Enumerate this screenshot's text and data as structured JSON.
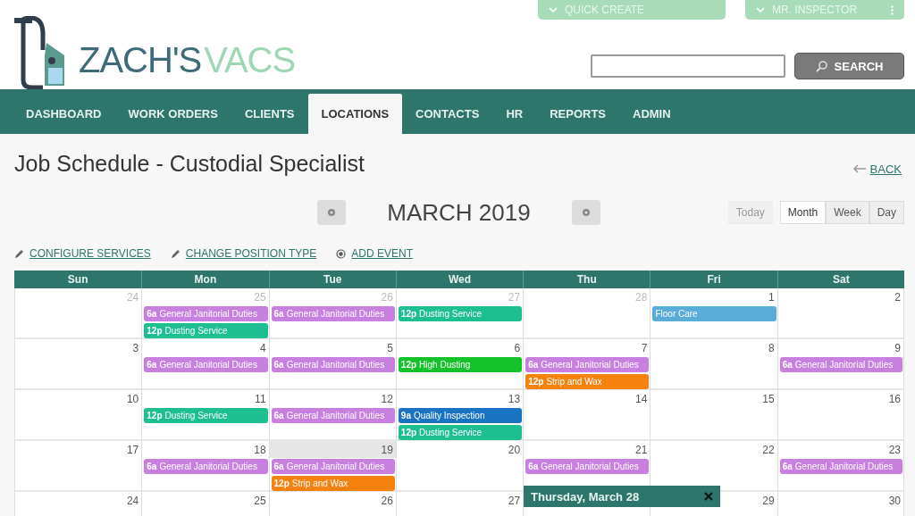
{
  "brand": {
    "name_part_1": "ZACH'S",
    "name_part_2": "VACS"
  },
  "top_menus": [
    {
      "label": "QUICK CREATE",
      "has_more": false
    },
    {
      "label": "MR. INSPECTOR",
      "has_more": true
    }
  ],
  "search": {
    "button": "SEARCH"
  },
  "nav": [
    {
      "label": "DASHBOARD",
      "selected": false
    },
    {
      "label": "WORK ORDERS",
      "selected": false
    },
    {
      "label": "CLIENTS",
      "selected": false
    },
    {
      "label": "LOCATIONS",
      "selected": true
    },
    {
      "label": "CONTACTS",
      "selected": false
    },
    {
      "label": "HR",
      "selected": false
    },
    {
      "label": "REPORTS",
      "selected": false
    },
    {
      "label": "ADMIN",
      "selected": false
    }
  ],
  "page_title": "Job Schedule - Custodial Specialist",
  "back_link": "BACK",
  "calendar": {
    "month_title": "MARCH 2019",
    "today_button": {
      "label": "Today",
      "disabled": true
    },
    "views": [
      {
        "label": "Month",
        "selected": true
      },
      {
        "label": "Week",
        "selected": false
      },
      {
        "label": "Day",
        "selected": false
      }
    ],
    "actions": [
      {
        "label": "CONFIGURE SERVICES",
        "kind": "edit"
      },
      {
        "label": "CHANGE POSITION TYPE",
        "kind": "edit"
      },
      {
        "label": "ADD EVENT",
        "kind": "add"
      }
    ],
    "weekdays": [
      "Sun",
      "Mon",
      "Tue",
      "Wed",
      "Thu",
      "Fri",
      "Sat"
    ],
    "weeks": [
      [
        {
          "day": "24",
          "other_month": true,
          "highlighted": false
        },
        {
          "day": "25",
          "other_month": true,
          "highlighted": false,
          "events": [
            {
              "time": "6a",
              "title": "General Janitorial Duties",
              "color": "#c77fe0"
            },
            {
              "time": "12p",
              "title": "Dusting Service",
              "color": "#1dbf91"
            }
          ]
        },
        {
          "day": "26",
          "other_month": true,
          "highlighted": false,
          "events": [
            {
              "time": "6a",
              "title": "General Janitorial Duties",
              "color": "#c77fe0"
            }
          ]
        },
        {
          "day": "27",
          "other_month": true,
          "highlighted": false,
          "events": [
            {
              "time": "12p",
              "title": "Dusting Service",
              "color": "#1dbf91"
            }
          ]
        },
        {
          "day": "28",
          "other_month": true,
          "highlighted": false
        },
        {
          "day": "1",
          "other_month": false,
          "highlighted": false,
          "events": [
            {
              "title": "Floor Care",
              "color": "#5aacd8"
            }
          ]
        },
        {
          "day": "2",
          "other_month": false,
          "highlighted": false
        }
      ],
      [
        {
          "day": "3",
          "other_month": false,
          "highlighted": false
        },
        {
          "day": "4",
          "other_month": false,
          "highlighted": false,
          "events": [
            {
              "time": "6a",
              "title": "General Janitorial Duties",
              "color": "#c77fe0"
            }
          ]
        },
        {
          "day": "5",
          "other_month": false,
          "highlighted": false,
          "events": [
            {
              "time": "6a",
              "title": "General Janitorial Duties",
              "color": "#c77fe0"
            }
          ]
        },
        {
          "day": "6",
          "other_month": false,
          "highlighted": false,
          "events": [
            {
              "time": "12p",
              "title": "High Dusting",
              "color": "#14c22a"
            }
          ]
        },
        {
          "day": "7",
          "other_month": false,
          "highlighted": false,
          "events": [
            {
              "time": "6a",
              "title": "General Janitorial Duties",
              "color": "#c77fe0"
            },
            {
              "time": "12p",
              "title": "Strip and Wax",
              "color": "#f5820f"
            }
          ]
        },
        {
          "day": "8",
          "other_month": false,
          "highlighted": false
        },
        {
          "day": "9",
          "other_month": false,
          "highlighted": false,
          "events": [
            {
              "time": "6a",
              "title": "General Janitorial Duties",
              "color": "#c77fe0"
            }
          ]
        }
      ],
      [
        {
          "day": "10",
          "other_month": false,
          "highlighted": false
        },
        {
          "day": "11",
          "other_month": false,
          "highlighted": false,
          "events": [
            {
              "time": "12p",
              "title": "Dusting Service",
              "color": "#1dbf91"
            }
          ]
        },
        {
          "day": "12",
          "other_month": false,
          "highlighted": false,
          "events": [
            {
              "time": "6a",
              "title": "General Janitorial Duties",
              "color": "#c77fe0"
            }
          ]
        },
        {
          "day": "13",
          "other_month": false,
          "highlighted": false,
          "events": [
            {
              "time": "9a",
              "title": "Quality Inspection",
              "color": "#1a72c2"
            },
            {
              "time": "12p",
              "title": "Dusting Service",
              "color": "#1dbf91"
            }
          ]
        },
        {
          "day": "14",
          "other_month": false,
          "highlighted": false
        },
        {
          "day": "15",
          "other_month": false,
          "highlighted": false
        },
        {
          "day": "16",
          "other_month": false,
          "highlighted": false
        }
      ],
      [
        {
          "day": "17",
          "other_month": false,
          "highlighted": false
        },
        {
          "day": "18",
          "other_month": false,
          "highlighted": false,
          "events": [
            {
              "time": "6a",
              "title": "General Janitorial Duties",
              "color": "#c77fe0"
            }
          ]
        },
        {
          "day": "19",
          "other_month": false,
          "highlighted": true,
          "events": [
            {
              "time": "6a",
              "title": "General Janitorial Duties",
              "color": "#c77fe0"
            },
            {
              "time": "12p",
              "title": "Strip and Wax",
              "color": "#f5820f"
            }
          ]
        },
        {
          "day": "20",
          "other_month": false,
          "highlighted": false
        },
        {
          "day": "21",
          "other_month": false,
          "highlighted": false,
          "events": [
            {
              "time": "6a",
              "title": "General Janitorial Duties",
              "color": "#c77fe0"
            }
          ]
        },
        {
          "day": "22",
          "other_month": false,
          "highlighted": false
        },
        {
          "day": "23",
          "other_month": false,
          "highlighted": false,
          "events": [
            {
              "time": "6a",
              "title": "General Janitorial Duties",
              "color": "#c77fe0"
            }
          ]
        }
      ],
      [
        {
          "day": "24",
          "other_month": false,
          "highlighted": false
        },
        {
          "day": "25",
          "other_month": false,
          "highlighted": false
        },
        {
          "day": "26",
          "other_month": false,
          "highlighted": false
        },
        {
          "day": "27",
          "other_month": false,
          "highlighted": false
        },
        {
          "popover": {
            "title": "Thursday, March 28"
          }
        },
        {
          "day": "29",
          "other_month": false,
          "highlighted": false
        },
        {
          "day": "30",
          "other_month": false,
          "highlighted": false
        }
      ]
    ]
  }
}
